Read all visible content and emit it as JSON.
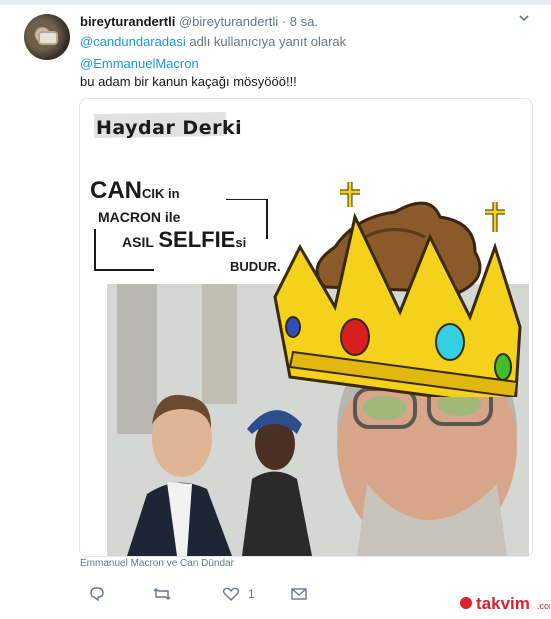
{
  "tweet": {
    "display_name": "bireyturandertli",
    "handle": "@bireyturandertli",
    "separator": "·",
    "time": "8 sa.",
    "reply_to_mention": "@candundaradasi",
    "reply_to_suffix": "adlı kullanıcıya yanıt olarak",
    "mention": "@EmmanuelMacron",
    "text": "bu adam bir kanun kaçağı mösyööö!!!"
  },
  "image": {
    "brand_text": "Haydar Derki",
    "caption_line1_big": "CAN",
    "caption_line1_small": "CIK in",
    "caption_line2_a": "MACRON",
    "caption_line2_b": "ile",
    "caption_line3_a": "ASIL",
    "caption_line3_big": "SELFIE",
    "caption_line3_small": "si",
    "caption_line4": "BUDUR."
  },
  "media_caption": "Emmanuel Macron ve Can Dündar",
  "actions": {
    "reply_icon": "reply-icon",
    "retweet_icon": "retweet-icon",
    "like_icon": "heart-icon",
    "like_count": "1",
    "dm_icon": "envelope-icon"
  },
  "watermark": "takvim",
  "colors": {
    "link": "#1b95e0",
    "muted": "#657786",
    "watermark_red": "#d9232e"
  }
}
